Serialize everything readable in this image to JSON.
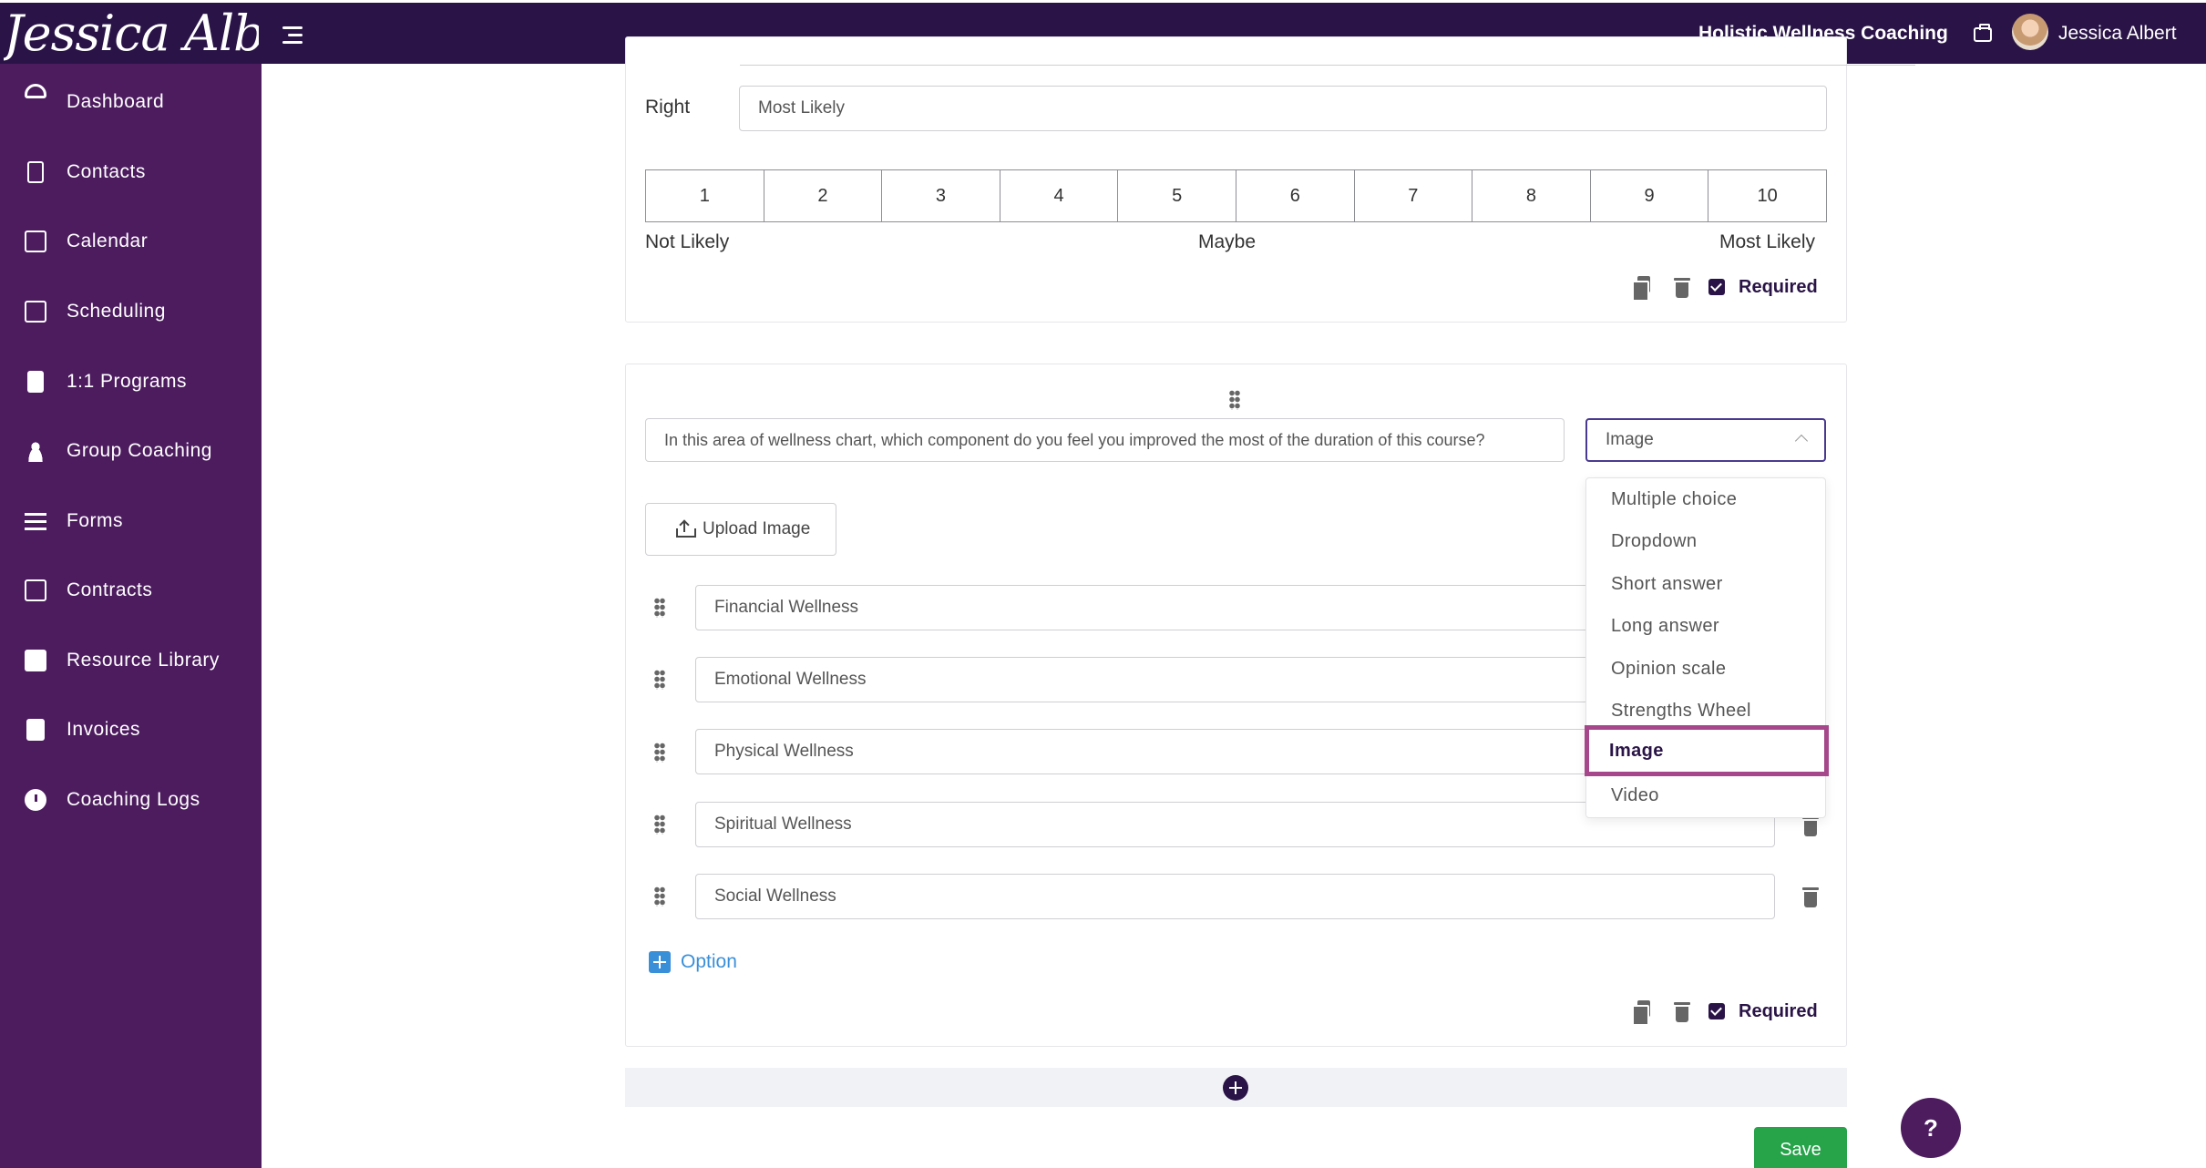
{
  "header": {
    "brand": "Jessica Albert",
    "business_name": "Holistic Wellness Coaching",
    "user_name": "Jessica Albert"
  },
  "sidebar": {
    "items": [
      {
        "label": "Dashboard",
        "icon": "dashboard-icon"
      },
      {
        "label": "Contacts",
        "icon": "contacts-icon"
      },
      {
        "label": "Calendar",
        "icon": "calendar-icon"
      },
      {
        "label": "Scheduling",
        "icon": "scheduling-icon"
      },
      {
        "label": "1:1 Programs",
        "icon": "book-icon"
      },
      {
        "label": "Group Coaching",
        "icon": "group-icon"
      },
      {
        "label": "Forms",
        "icon": "list-icon"
      },
      {
        "label": "Contracts",
        "icon": "edit-icon"
      },
      {
        "label": "Resource Library",
        "icon": "library-icon"
      },
      {
        "label": "Invoices",
        "icon": "invoice-icon"
      },
      {
        "label": "Coaching Logs",
        "icon": "clock-icon"
      }
    ]
  },
  "scale_question": {
    "right_label": "Right",
    "right_value": "Most Likely",
    "scale": [
      "1",
      "2",
      "3",
      "4",
      "5",
      "6",
      "7",
      "8",
      "9",
      "10"
    ],
    "low_label": "Not Likely",
    "mid_label": "Maybe",
    "high_label": "Most Likely",
    "required_label": "Required"
  },
  "image_question": {
    "question_text": "In this area of wellness chart, which component do you feel you improved the most of the duration of this course?",
    "type_selected": "Image",
    "upload_label": "Upload Image",
    "options": [
      "Financial Wellness",
      "Emotional Wellness",
      "Physical Wellness",
      "Spiritual Wellness",
      "Social Wellness"
    ],
    "add_option_label": "Option",
    "required_label": "Required"
  },
  "type_dropdown": {
    "items": [
      "Multiple choice",
      "Dropdown",
      "Short answer",
      "Long answer",
      "Opinion scale",
      "Strengths Wheel",
      "Image",
      "Video"
    ],
    "active": "Image"
  },
  "actions": {
    "save_label": "Save",
    "help_label": "?"
  },
  "colors": {
    "topbar": "#2a1447",
    "sidebar": "#4d1c5f",
    "accent_link": "#3a8fd9",
    "save_green": "#27a34a",
    "highlight": "#a5478a"
  }
}
